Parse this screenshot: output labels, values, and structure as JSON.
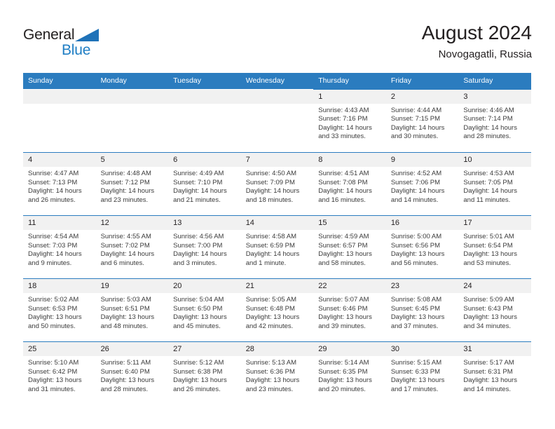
{
  "brand": {
    "name_top": "General",
    "name_bottom": "Blue",
    "accent_color": "#1f7ec4",
    "triangle_icon": "triangle-icon"
  },
  "header": {
    "month_title": "August 2024",
    "location": "Novogagatli, Russia"
  },
  "colors": {
    "header_blue": "#2b7cbf",
    "daynum_band": "#f1f1f1",
    "text": "#231f20"
  },
  "weekdays": [
    "Sunday",
    "Monday",
    "Tuesday",
    "Wednesday",
    "Thursday",
    "Friday",
    "Saturday"
  ],
  "weeks": [
    [
      {
        "day": "",
        "lines": []
      },
      {
        "day": "",
        "lines": []
      },
      {
        "day": "",
        "lines": []
      },
      {
        "day": "",
        "lines": []
      },
      {
        "day": "1",
        "lines": [
          "Sunrise: 4:43 AM",
          "Sunset: 7:16 PM",
          "Daylight: 14 hours",
          "and 33 minutes."
        ]
      },
      {
        "day": "2",
        "lines": [
          "Sunrise: 4:44 AM",
          "Sunset: 7:15 PM",
          "Daylight: 14 hours",
          "and 30 minutes."
        ]
      },
      {
        "day": "3",
        "lines": [
          "Sunrise: 4:46 AM",
          "Sunset: 7:14 PM",
          "Daylight: 14 hours",
          "and 28 minutes."
        ]
      }
    ],
    [
      {
        "day": "4",
        "lines": [
          "Sunrise: 4:47 AM",
          "Sunset: 7:13 PM",
          "Daylight: 14 hours",
          "and 26 minutes."
        ]
      },
      {
        "day": "5",
        "lines": [
          "Sunrise: 4:48 AM",
          "Sunset: 7:12 PM",
          "Daylight: 14 hours",
          "and 23 minutes."
        ]
      },
      {
        "day": "6",
        "lines": [
          "Sunrise: 4:49 AM",
          "Sunset: 7:10 PM",
          "Daylight: 14 hours",
          "and 21 minutes."
        ]
      },
      {
        "day": "7",
        "lines": [
          "Sunrise: 4:50 AM",
          "Sunset: 7:09 PM",
          "Daylight: 14 hours",
          "and 18 minutes."
        ]
      },
      {
        "day": "8",
        "lines": [
          "Sunrise: 4:51 AM",
          "Sunset: 7:08 PM",
          "Daylight: 14 hours",
          "and 16 minutes."
        ]
      },
      {
        "day": "9",
        "lines": [
          "Sunrise: 4:52 AM",
          "Sunset: 7:06 PM",
          "Daylight: 14 hours",
          "and 14 minutes."
        ]
      },
      {
        "day": "10",
        "lines": [
          "Sunrise: 4:53 AM",
          "Sunset: 7:05 PM",
          "Daylight: 14 hours",
          "and 11 minutes."
        ]
      }
    ],
    [
      {
        "day": "11",
        "lines": [
          "Sunrise: 4:54 AM",
          "Sunset: 7:03 PM",
          "Daylight: 14 hours",
          "and 9 minutes."
        ]
      },
      {
        "day": "12",
        "lines": [
          "Sunrise: 4:55 AM",
          "Sunset: 7:02 PM",
          "Daylight: 14 hours",
          "and 6 minutes."
        ]
      },
      {
        "day": "13",
        "lines": [
          "Sunrise: 4:56 AM",
          "Sunset: 7:00 PM",
          "Daylight: 14 hours",
          "and 3 minutes."
        ]
      },
      {
        "day": "14",
        "lines": [
          "Sunrise: 4:58 AM",
          "Sunset: 6:59 PM",
          "Daylight: 14 hours",
          "and 1 minute."
        ]
      },
      {
        "day": "15",
        "lines": [
          "Sunrise: 4:59 AM",
          "Sunset: 6:57 PM",
          "Daylight: 13 hours",
          "and 58 minutes."
        ]
      },
      {
        "day": "16",
        "lines": [
          "Sunrise: 5:00 AM",
          "Sunset: 6:56 PM",
          "Daylight: 13 hours",
          "and 56 minutes."
        ]
      },
      {
        "day": "17",
        "lines": [
          "Sunrise: 5:01 AM",
          "Sunset: 6:54 PM",
          "Daylight: 13 hours",
          "and 53 minutes."
        ]
      }
    ],
    [
      {
        "day": "18",
        "lines": [
          "Sunrise: 5:02 AM",
          "Sunset: 6:53 PM",
          "Daylight: 13 hours",
          "and 50 minutes."
        ]
      },
      {
        "day": "19",
        "lines": [
          "Sunrise: 5:03 AM",
          "Sunset: 6:51 PM",
          "Daylight: 13 hours",
          "and 48 minutes."
        ]
      },
      {
        "day": "20",
        "lines": [
          "Sunrise: 5:04 AM",
          "Sunset: 6:50 PM",
          "Daylight: 13 hours",
          "and 45 minutes."
        ]
      },
      {
        "day": "21",
        "lines": [
          "Sunrise: 5:05 AM",
          "Sunset: 6:48 PM",
          "Daylight: 13 hours",
          "and 42 minutes."
        ]
      },
      {
        "day": "22",
        "lines": [
          "Sunrise: 5:07 AM",
          "Sunset: 6:46 PM",
          "Daylight: 13 hours",
          "and 39 minutes."
        ]
      },
      {
        "day": "23",
        "lines": [
          "Sunrise: 5:08 AM",
          "Sunset: 6:45 PM",
          "Daylight: 13 hours",
          "and 37 minutes."
        ]
      },
      {
        "day": "24",
        "lines": [
          "Sunrise: 5:09 AM",
          "Sunset: 6:43 PM",
          "Daylight: 13 hours",
          "and 34 minutes."
        ]
      }
    ],
    [
      {
        "day": "25",
        "lines": [
          "Sunrise: 5:10 AM",
          "Sunset: 6:42 PM",
          "Daylight: 13 hours",
          "and 31 minutes."
        ]
      },
      {
        "day": "26",
        "lines": [
          "Sunrise: 5:11 AM",
          "Sunset: 6:40 PM",
          "Daylight: 13 hours",
          "and 28 minutes."
        ]
      },
      {
        "day": "27",
        "lines": [
          "Sunrise: 5:12 AM",
          "Sunset: 6:38 PM",
          "Daylight: 13 hours",
          "and 26 minutes."
        ]
      },
      {
        "day": "28",
        "lines": [
          "Sunrise: 5:13 AM",
          "Sunset: 6:36 PM",
          "Daylight: 13 hours",
          "and 23 minutes."
        ]
      },
      {
        "day": "29",
        "lines": [
          "Sunrise: 5:14 AM",
          "Sunset: 6:35 PM",
          "Daylight: 13 hours",
          "and 20 minutes."
        ]
      },
      {
        "day": "30",
        "lines": [
          "Sunrise: 5:15 AM",
          "Sunset: 6:33 PM",
          "Daylight: 13 hours",
          "and 17 minutes."
        ]
      },
      {
        "day": "31",
        "lines": [
          "Sunrise: 5:17 AM",
          "Sunset: 6:31 PM",
          "Daylight: 13 hours",
          "and 14 minutes."
        ]
      }
    ]
  ]
}
